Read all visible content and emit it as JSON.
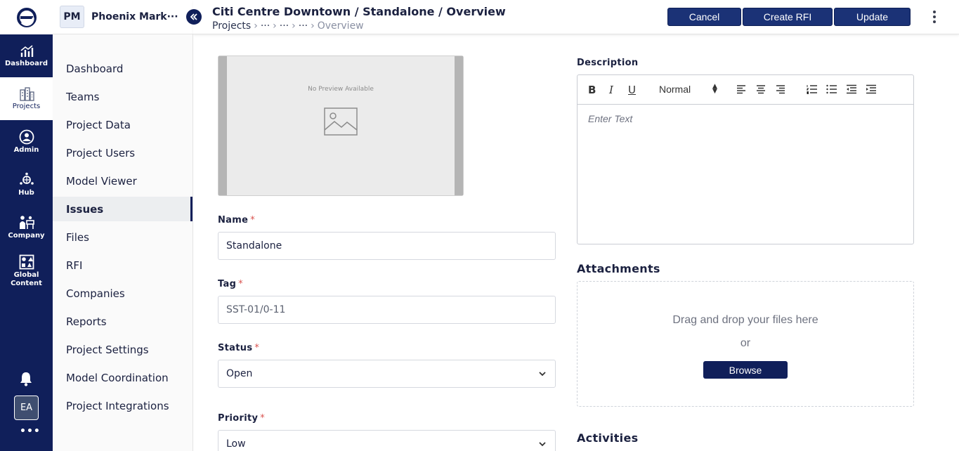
{
  "rail": {
    "items": [
      {
        "label": "Dashboard",
        "icon": "chart-icon"
      },
      {
        "label": "Projects",
        "icon": "buildings-icon"
      },
      {
        "label": "Admin",
        "icon": "admin-icon"
      },
      {
        "label": "Hub",
        "icon": "hub-icon"
      },
      {
        "label": "Company",
        "icon": "company-icon"
      },
      {
        "label": "Global Content",
        "icon": "shapes-icon"
      }
    ],
    "avatar": "EA",
    "more": "•••"
  },
  "project": {
    "badge": "PM",
    "name": "Phoenix Mark···"
  },
  "header": {
    "title": "Citi Centre Downtown / Standalone / Overview",
    "breadcrumb": [
      "Projects",
      "···",
      "···",
      "···",
      "Overview"
    ],
    "buttons": {
      "cancel": "Cancel",
      "create_rfi": "Create RFI",
      "update": "Update"
    }
  },
  "sidebar": {
    "items": [
      {
        "label": "Dashboard"
      },
      {
        "label": "Teams"
      },
      {
        "label": "Project Data"
      },
      {
        "label": "Project Users"
      },
      {
        "label": "Model Viewer"
      },
      {
        "label": "Issues",
        "active": true
      },
      {
        "label": "Files"
      },
      {
        "label": "RFI"
      },
      {
        "label": "Companies"
      },
      {
        "label": "Reports"
      },
      {
        "label": "Project Settings"
      },
      {
        "label": "Model Coordination"
      },
      {
        "label": "Project Integrations"
      }
    ]
  },
  "preview": {
    "text": "No Preview Available"
  },
  "form": {
    "name": {
      "label": "Name",
      "value": "Standalone"
    },
    "tag": {
      "label": "Tag",
      "value": "SST-01/0-11"
    },
    "status": {
      "label": "Status",
      "value": "Open"
    },
    "priority": {
      "label": "Priority",
      "value": "Low"
    },
    "required_mark": "*"
  },
  "description": {
    "label": "Description",
    "toolbar": {
      "bold": "B",
      "italic": "I",
      "underline": "U",
      "heading": "Normal"
    },
    "placeholder": "Enter Text"
  },
  "attachments": {
    "label": "Attachments",
    "drop_text": "Drag and drop your files here",
    "or": "or",
    "browse": "Browse"
  },
  "activities": {
    "label": "Activities"
  },
  "colors": {
    "navy": "#101f5a",
    "button": "#1b3276",
    "required": "#d9534f"
  }
}
